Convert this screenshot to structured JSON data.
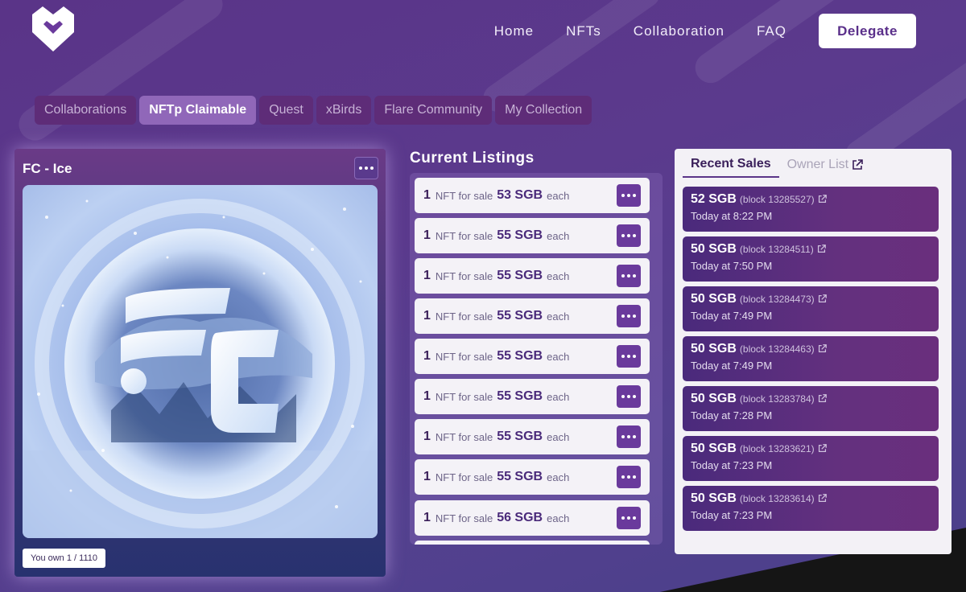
{
  "nav": {
    "links": [
      "Home",
      "NFTs",
      "Collaboration",
      "FAQ"
    ],
    "delegate_label": "Delegate"
  },
  "tabs": [
    {
      "label": "Collaborations",
      "active": false
    },
    {
      "label": "NFTp Claimable",
      "active": true
    },
    {
      "label": "Quest",
      "active": false
    },
    {
      "label": "xBirds",
      "active": false
    },
    {
      "label": "Flare Community",
      "active": false
    },
    {
      "label": "My Collection",
      "active": false
    }
  ],
  "card": {
    "title": "FC - Ice",
    "ownership": "You own 1 / 1110",
    "image_icon": "fc-ice-orb-image"
  },
  "listings": {
    "title": "Current Listings",
    "item_label": "NFT for sale",
    "unit": "each",
    "items": [
      {
        "qty": "1",
        "price": "53 SGB"
      },
      {
        "qty": "1",
        "price": "55 SGB"
      },
      {
        "qty": "1",
        "price": "55 SGB"
      },
      {
        "qty": "1",
        "price": "55 SGB"
      },
      {
        "qty": "1",
        "price": "55 SGB"
      },
      {
        "qty": "1",
        "price": "55 SGB"
      },
      {
        "qty": "1",
        "price": "55 SGB"
      },
      {
        "qty": "1",
        "price": "55 SGB"
      },
      {
        "qty": "1",
        "price": "56 SGB"
      }
    ]
  },
  "sales": {
    "tab_recent": "Recent Sales",
    "tab_owner": "Owner List",
    "items": [
      {
        "amount": "52 SGB",
        "block": "(block 13285527)",
        "time": "Today at 8:22 PM"
      },
      {
        "amount": "50 SGB",
        "block": "(block 13284511)",
        "time": "Today at 7:50 PM"
      },
      {
        "amount": "50 SGB",
        "block": "(block 13284473)",
        "time": "Today at 7:49 PM"
      },
      {
        "amount": "50 SGB",
        "block": "(block 13284463)",
        "time": "Today at 7:49 PM"
      },
      {
        "amount": "50 SGB",
        "block": "(block 13283784)",
        "time": "Today at 7:28 PM"
      },
      {
        "amount": "50 SGB",
        "block": "(block 13283621)",
        "time": "Today at 7:23 PM"
      },
      {
        "amount": "50 SGB",
        "block": "(block 13283614)",
        "time": "Today at 7:23 PM"
      }
    ]
  },
  "colors": {
    "accent": "#5a3488",
    "active_tab": "#9067b9",
    "sale_card": "#4a2a7c"
  }
}
